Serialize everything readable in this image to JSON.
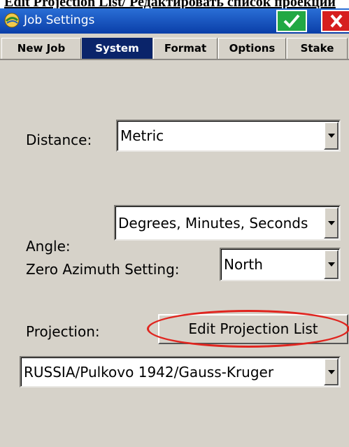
{
  "document": {
    "caption": "Edit Projection List/ Редактировать список проекций"
  },
  "titlebar": {
    "title": "Job Settings",
    "icon": "app-logo-icon"
  },
  "tabs": [
    {
      "label": "New Job"
    },
    {
      "label": "System",
      "active": true
    },
    {
      "label": "Format"
    },
    {
      "label": "Options"
    },
    {
      "label": "Stake"
    }
  ],
  "form": {
    "distance": {
      "label": "Distance:",
      "value": "Metric"
    },
    "angle": {
      "label": "Angle:",
      "value": "Degrees, Minutes, Seconds"
    },
    "zero_azimuth": {
      "label": "Zero Azimuth Setting:",
      "value": "North"
    },
    "projection": {
      "label": "Projection:",
      "button": "Edit Projection List",
      "value": "RUSSIA/Pulkovo 1942/Gauss-Kruger"
    }
  },
  "colors": {
    "title_bar": "#0a3ea8",
    "active_tab": "#0a246a",
    "ok": "#22a844",
    "close": "#d61e1e",
    "highlight_ellipse": "#e0251f"
  }
}
